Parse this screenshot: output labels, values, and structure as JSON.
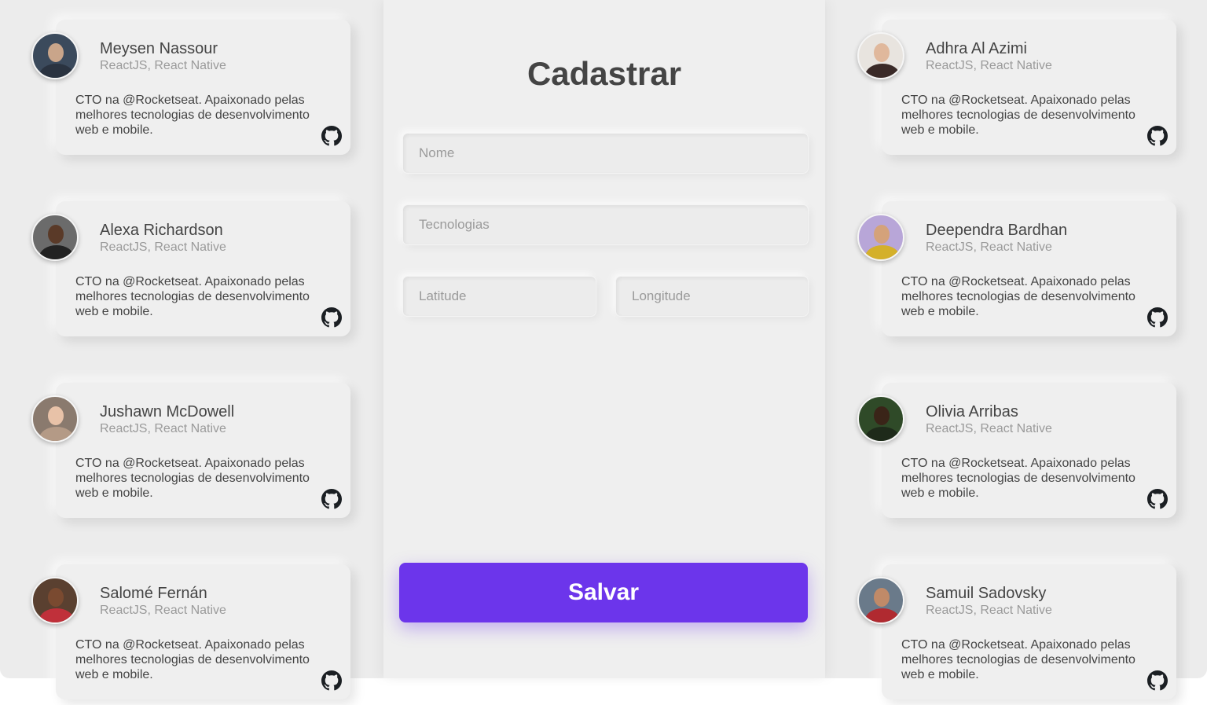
{
  "form": {
    "title": "Cadastrar",
    "name_placeholder": "Nome",
    "techs_placeholder": "Tecnologias",
    "latitude_placeholder": "Latitude",
    "longitude_placeholder": "Longitude",
    "save_label": "Salvar"
  },
  "colors": {
    "accent": "#6c35eb",
    "background": "#ececec"
  },
  "icons": {
    "github": "github-icon"
  },
  "devs": [
    {
      "name": "Meysen Nassour",
      "techs": "ReactJS, React Native",
      "bio": "CTO na @Rocketseat. Apaixonado pelas melhores tecnologias de desenvolvimento web e mobile.",
      "avatar_bg": "#3b4a5c",
      "avatar_face": "#c9a58a",
      "avatar_body": "#2a3340"
    },
    {
      "name": "Alexa Richardson",
      "techs": "ReactJS, React Native",
      "bio": "CTO na @Rocketseat. Apaixonado pelas melhores tecnologias de desenvolvimento web e mobile.",
      "avatar_bg": "#6b6b6b",
      "avatar_face": "#5a3a28",
      "avatar_body": "#222222"
    },
    {
      "name": "Jushawn McDowell",
      "techs": "ReactJS, React Native",
      "bio": "CTO na @Rocketseat. Apaixonado pelas melhores tecnologias de desenvolvimento web e mobile.",
      "avatar_bg": "#8a7a6e",
      "avatar_face": "#e8c2a8",
      "avatar_body": "#b49a86"
    },
    {
      "name": "Salomé Fernán",
      "techs": "ReactJS, React Native",
      "bio": "CTO na @Rocketseat. Apaixonado pelas melhores tecnologias de desenvolvimento web e mobile.",
      "avatar_bg": "#5a4030",
      "avatar_face": "#7a4a30",
      "avatar_body": "#c0303a"
    },
    {
      "name": "Adhra Al Azimi",
      "techs": "ReactJS, React Native",
      "bio": "CTO na @Rocketseat. Apaixonado pelas melhores tecnologias de desenvolvimento web e mobile.",
      "avatar_bg": "#e8e4df",
      "avatar_face": "#e0b89c",
      "avatar_body": "#3a2a28"
    },
    {
      "name": "Deependra Bardhan",
      "techs": "ReactJS, React Native",
      "bio": "CTO na @Rocketseat. Apaixonado pelas melhores tecnologias de desenvolvimento web e mobile.",
      "avatar_bg": "#b8a6d8",
      "avatar_face": "#d4a27a",
      "avatar_body": "#d4b02a"
    },
    {
      "name": "Olivia Arribas",
      "techs": "ReactJS, React Native",
      "bio": "CTO na @Rocketseat. Apaixonado pelas melhores tecnologias de desenvolvimento web e mobile.",
      "avatar_bg": "#2f4a28",
      "avatar_face": "#3a2418",
      "avatar_body": "#1e2a1a"
    },
    {
      "name": "Samuil Sadovsky",
      "techs": "ReactJS, React Native",
      "bio": "CTO na @Rocketseat. Apaixonado pelas melhores tecnologias de desenvolvimento web e mobile.",
      "avatar_bg": "#6a7a8a",
      "avatar_face": "#c08a68",
      "avatar_body": "#b02a30"
    }
  ]
}
